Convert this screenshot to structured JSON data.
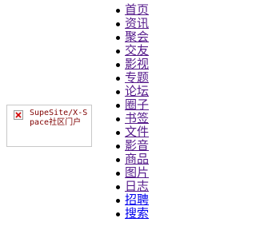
{
  "logo": {
    "alt_text": "SupeSite/X-Space社区门户",
    "icon": "broken-image-icon"
  },
  "nav": {
    "items": [
      {
        "label": "首页",
        "visited": true
      },
      {
        "label": "资讯",
        "visited": true
      },
      {
        "label": "聚会",
        "visited": true
      },
      {
        "label": "交友",
        "visited": true
      },
      {
        "label": "影视",
        "visited": true
      },
      {
        "label": "专题",
        "visited": true
      },
      {
        "label": "论坛",
        "visited": true
      },
      {
        "label": "圈子",
        "visited": true
      },
      {
        "label": "书签",
        "visited": true
      },
      {
        "label": "文件",
        "visited": true
      },
      {
        "label": "影音",
        "visited": true
      },
      {
        "label": "商品",
        "visited": true
      },
      {
        "label": "图片",
        "visited": true
      },
      {
        "label": "日志",
        "visited": true
      },
      {
        "label": "招聘",
        "visited": false
      },
      {
        "label": "搜索",
        "visited": false
      }
    ]
  },
  "colors": {
    "visited_link": "#551a8b",
    "unvisited_link": "#0000ee",
    "alt_text": "#800000"
  }
}
